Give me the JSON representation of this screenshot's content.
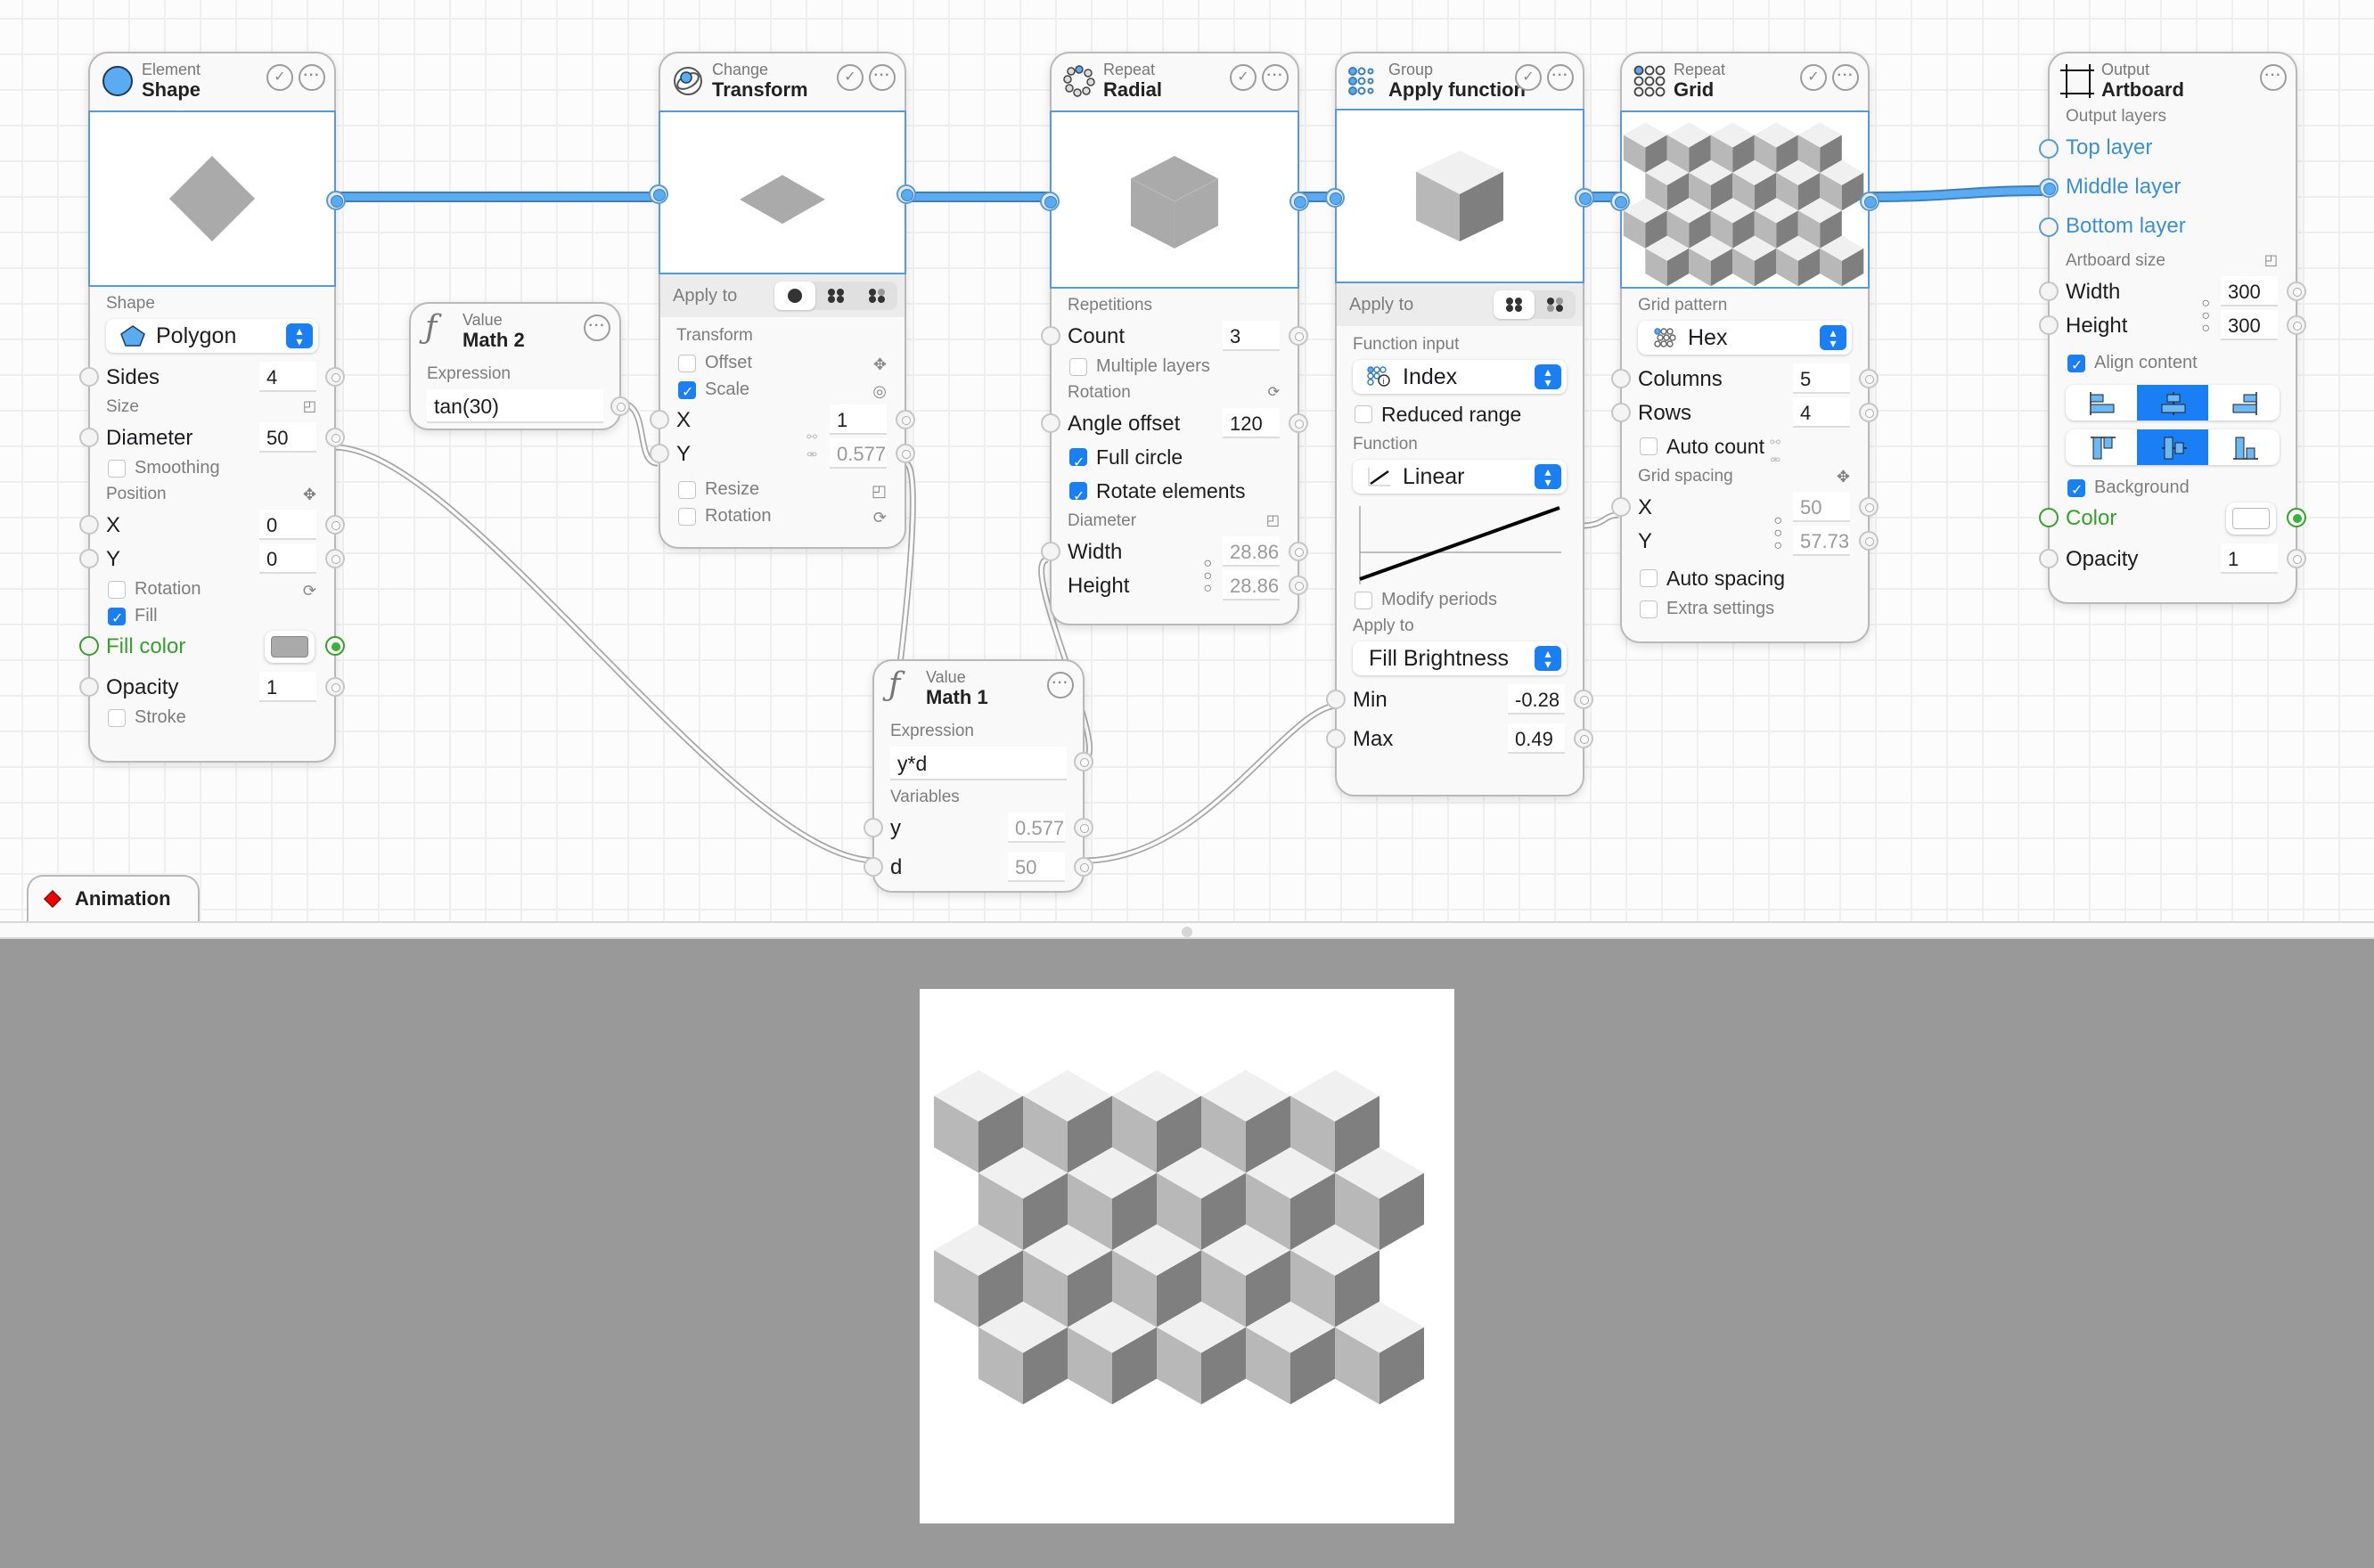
{
  "nodes": {
    "shape": {
      "category": "Element",
      "title": "Shape",
      "shape_label": "Shape",
      "shape_value": "Polygon",
      "sides_label": "Sides",
      "sides": "4",
      "size_label": "Size",
      "diameter_label": "Diameter",
      "diameter": "50",
      "smoothing_label": "Smoothing",
      "smoothing": false,
      "position_label": "Position",
      "x_label": "X",
      "x": "0",
      "y_label": "Y",
      "y": "0",
      "rotation_label": "Rotation",
      "rotation": false,
      "fill_label": "Fill",
      "fill": true,
      "fill_color_label": "Fill color",
      "fill_color": "#aaaaaa",
      "opacity_label": "Opacity",
      "opacity": "1",
      "stroke_label": "Stroke",
      "stroke": false
    },
    "math2": {
      "category": "Value",
      "title": "Math 2",
      "expression_label": "Expression",
      "expression": "tan(30)"
    },
    "transform": {
      "category": "Change",
      "title": "Transform",
      "apply_to_label": "Apply to",
      "apply_to_options": [
        "single",
        "all",
        "alternate"
      ],
      "apply_to_selected": "single",
      "transform_label": "Transform",
      "offset_label": "Offset",
      "offset": false,
      "scale_label": "Scale",
      "scale": true,
      "x_label": "X",
      "x": "1",
      "y_label": "Y",
      "y": "0.577",
      "resize_label": "Resize",
      "resize": false,
      "rotation_label": "Rotation",
      "rotation": false
    },
    "math1": {
      "category": "Value",
      "title": "Math 1",
      "expression_label": "Expression",
      "expression": "y*d",
      "variables_label": "Variables",
      "variables": [
        {
          "name": "y",
          "value": "0.577"
        },
        {
          "name": "d",
          "value": "50"
        }
      ]
    },
    "radial": {
      "category": "Repeat",
      "title": "Radial",
      "repetitions_label": "Repetitions",
      "count_label": "Count",
      "count": "3",
      "multiple_layers_label": "Multiple layers",
      "multiple_layers": false,
      "rotation_label": "Rotation",
      "angle_offset_label": "Angle offset",
      "angle_offset": "120",
      "full_circle_label": "Full circle",
      "full_circle": true,
      "rotate_elements_label": "Rotate elements",
      "rotate_elements": true,
      "diameter_label": "Diameter",
      "width_label": "Width",
      "width": "28.86",
      "height_label": "Height",
      "height": "28.86"
    },
    "apply_function": {
      "category": "Group",
      "title": "Apply function",
      "apply_to_label": "Apply to",
      "function_input_label": "Function input",
      "function_input": "Index",
      "reduced_range_label": "Reduced range",
      "reduced_range": false,
      "function_label": "Function",
      "function": "Linear",
      "modify_periods_label": "Modify periods",
      "modify_periods": false,
      "apply_to2_label": "Apply to",
      "apply_to_property": "Fill Brightness",
      "min_label": "Min",
      "min": "-0.28",
      "max_label": "Max",
      "max": "0.49"
    },
    "grid": {
      "category": "Repeat",
      "title": "Grid",
      "grid_pattern_label": "Grid pattern",
      "grid_pattern": "Hex",
      "columns_label": "Columns",
      "columns": "5",
      "rows_label": "Rows",
      "rows": "4",
      "auto_count_label": "Auto count",
      "auto_count": false,
      "grid_spacing_label": "Grid spacing",
      "x_label": "X",
      "x": "50",
      "y_label": "Y",
      "y": "57.73",
      "auto_spacing_label": "Auto spacing",
      "auto_spacing": false,
      "extra_settings_label": "Extra settings",
      "extra_settings": false
    },
    "artboard": {
      "category": "Output",
      "title": "Artboard",
      "output_layers_label": "Output layers",
      "layers": [
        "Top layer",
        "Middle layer",
        "Bottom layer"
      ],
      "artboard_size_label": "Artboard size",
      "width_label": "Width",
      "width": "300",
      "height_label": "Height",
      "height": "300",
      "align_content_label": "Align content",
      "align_content": true,
      "align_horizontal_selected": "center",
      "align_vertical_selected": "center",
      "background_label": "Background",
      "background": true,
      "color_label": "Color",
      "color": "#ffffff",
      "opacity_label": "Opacity",
      "opacity": "1"
    }
  },
  "animation_tab": {
    "label": "Animation"
  },
  "colors": {
    "accent": "#1a7ff5",
    "wire_active": "#5aabf2",
    "cube_top": "#f0f0f0",
    "cube_left": "#b8b8b8",
    "cube_right": "#7f7f7f",
    "stage_bg": "#999999"
  },
  "output_preview": {
    "columns": 5,
    "rows": 4,
    "pattern": "hex"
  }
}
